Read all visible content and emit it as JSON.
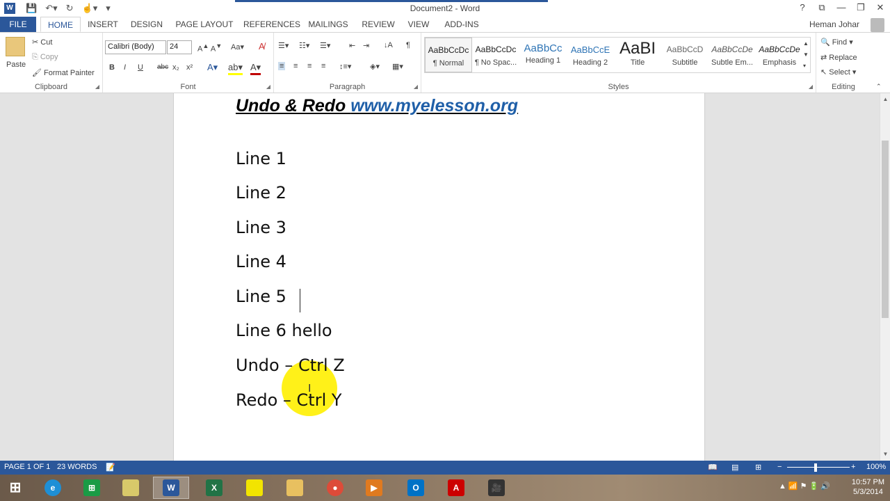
{
  "title_bar": {
    "app_icon": "W",
    "document_title": "Document2 - Word",
    "qat": [
      "save-icon",
      "undo-icon",
      "redo-icon",
      "touch-mode-icon",
      "customize-qat-icon"
    ],
    "window_controls": [
      "?",
      "⧉",
      "—",
      "❐",
      "✕"
    ]
  },
  "tabs": [
    "FILE",
    "HOME",
    "INSERT",
    "DESIGN",
    "PAGE LAYOUT",
    "REFERENCES",
    "MAILINGS",
    "REVIEW",
    "VIEW",
    "ADD-INS"
  ],
  "active_tab": "HOME",
  "user_name": "Heman Johar",
  "clipboard": {
    "paste": "Paste",
    "cut": "Cut",
    "copy": "Copy",
    "format_painter": "Format Painter",
    "label": "Clipboard"
  },
  "font": {
    "family": "Calibri (Body)",
    "size": "24",
    "label": "Font",
    "buttons": [
      "B",
      "I",
      "U",
      "abc",
      "x₂",
      "x²"
    ]
  },
  "paragraph": {
    "label": "Paragraph"
  },
  "styles": {
    "label": "Styles",
    "items": [
      {
        "preview": "AaBbCcDc",
        "name": "¶ Normal"
      },
      {
        "preview": "AaBbCcDc",
        "name": "¶ No Spac..."
      },
      {
        "preview": "AaBbCc",
        "name": "Heading 1"
      },
      {
        "preview": "AaBbCcE",
        "name": "Heading 2"
      },
      {
        "preview": "AaBI",
        "name": "Title"
      },
      {
        "preview": "AaBbCcD",
        "name": "Subtitle"
      },
      {
        "preview": "AaBbCcDe",
        "name": "Subtle Em..."
      },
      {
        "preview": "AaBbCcDe",
        "name": "Emphasis"
      }
    ]
  },
  "editing": {
    "find": "Find",
    "replace": "Replace",
    "select": "Select",
    "label": "Editing"
  },
  "document": {
    "heading_text": "Undo & Redo ",
    "heading_link": "www.myelesson.org",
    "lines": [
      "Line 1",
      "Line 2",
      "Line 3",
      "Line 4",
      "Line 5",
      "Line 6 hello",
      "Undo – Ctrl Z",
      "Redo – Ctrl Y"
    ]
  },
  "status_bar": {
    "page": "PAGE 1 OF 1",
    "words": "23 WORDS",
    "zoom": "100%"
  },
  "taskbar": {
    "time": "10:57 PM",
    "date": "5/3/2014"
  },
  "colors": {
    "accent": "#2b579a",
    "link": "#1f5fa8",
    "highlight": "#fff000"
  }
}
